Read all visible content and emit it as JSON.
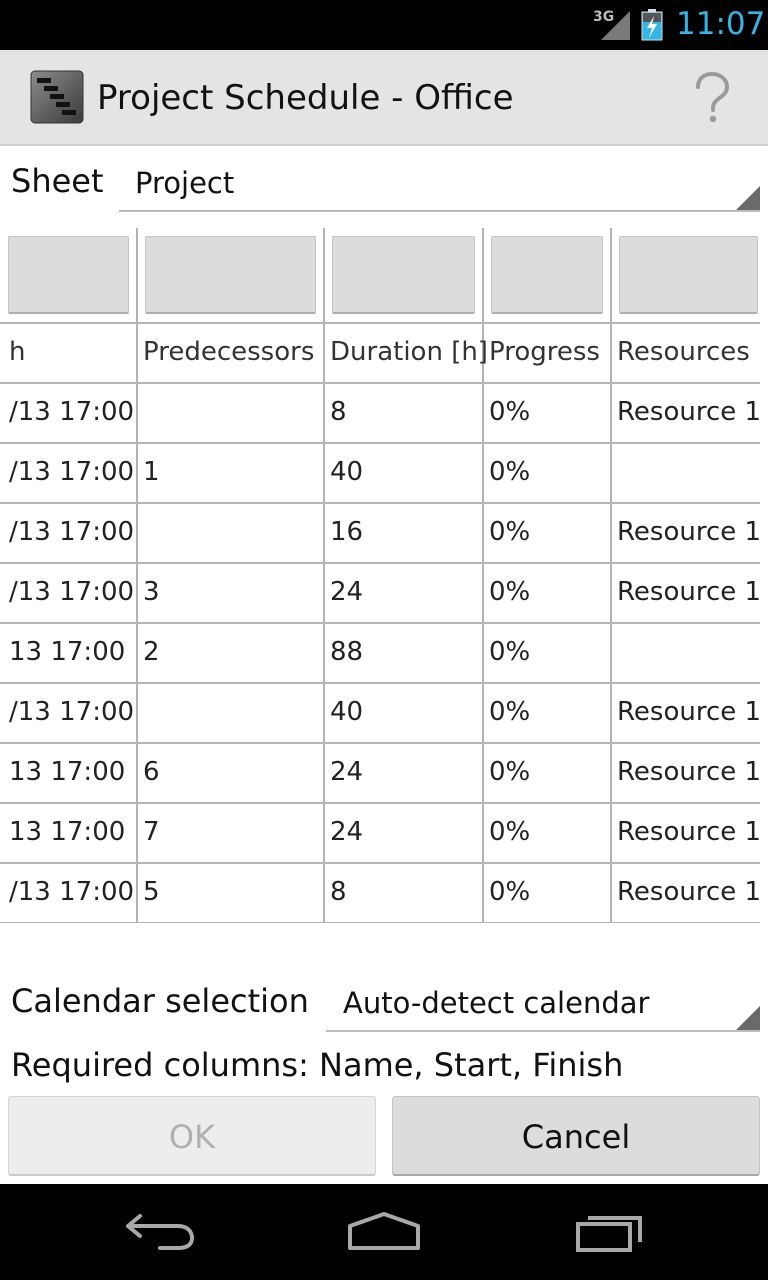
{
  "status_bar": {
    "network": "3G",
    "time": "11:07",
    "time_color": "#33b5e5"
  },
  "action_bar": {
    "app_icon": "gantt-chart-icon",
    "title": "Project Schedule - Office",
    "help_icon": "question-mark-icon"
  },
  "sheet": {
    "label": "Sheet",
    "value": "Project"
  },
  "table": {
    "columns": [
      "h",
      "Predecessors",
      "Duration [h]",
      "Progress",
      "Resources"
    ],
    "rows": [
      [
        "/13 17:00",
        "",
        "8",
        "0%",
        "Resource 1"
      ],
      [
        "/13 17:00",
        "1",
        "40",
        "0%",
        ""
      ],
      [
        "/13 17:00",
        "",
        "16",
        "0%",
        "Resource 1"
      ],
      [
        "/13 17:00",
        "3",
        "24",
        "0%",
        "Resource 1"
      ],
      [
        "13 17:00",
        "2",
        "88",
        "0%",
        ""
      ],
      [
        "/13 17:00",
        "",
        "40",
        "0%",
        "Resource 1"
      ],
      [
        "13 17:00",
        "6",
        "24",
        "0%",
        "Resource 1"
      ],
      [
        "13 17:00",
        "7",
        "24",
        "0%",
        "Resource 1"
      ],
      [
        "/13 17:00",
        "5",
        "8",
        "0%",
        "Resource 1"
      ]
    ]
  },
  "calendar": {
    "label": "Calendar selection",
    "value": "Auto-detect calendar"
  },
  "required_text": "Required columns: Name, Start, Finish",
  "buttons": {
    "ok": "OK",
    "cancel": "Cancel"
  },
  "nav_bar": {
    "back_icon": "back-icon",
    "home_icon": "home-icon",
    "recents_icon": "recent-apps-icon"
  }
}
